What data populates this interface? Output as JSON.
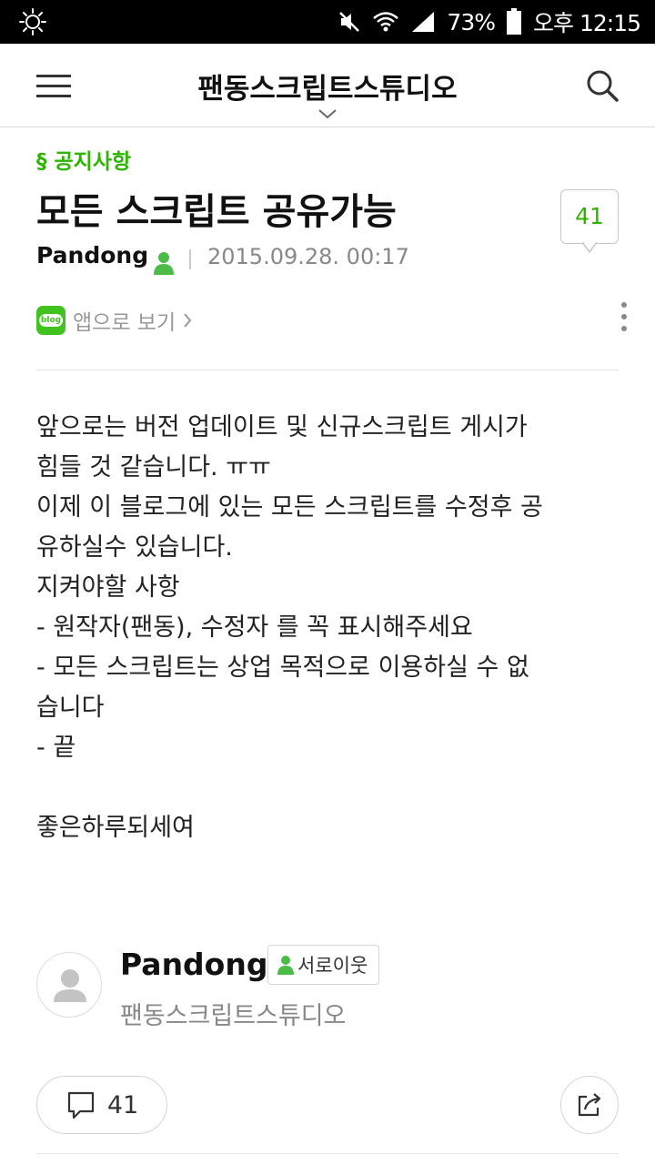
{
  "status_bar": {
    "battery": "73%",
    "time": "오후 12:15",
    "icons": [
      "brightness-icon",
      "mute-icon",
      "wifi-icon",
      "signal-icon",
      "battery-icon"
    ]
  },
  "app_bar": {
    "blog_title": "팬동스크립트스튜디오",
    "icons": [
      "menu-icon",
      "chevron-down-icon",
      "search-icon"
    ]
  },
  "post": {
    "category": "§ 공지사항",
    "title": "모든 스크립트 공유가능",
    "comment_count": "41",
    "author": "Pandong",
    "date": "2015.09.28. 00:17",
    "app_view_label": "앱으로 보기",
    "blog_logo_text": "blog",
    "body_lines": [
      "앞으로는 버전 업데이트 및 신규스크립트 게시가",
      "힘들 것 같습니다. ㅠㅠ",
      "이제 이 블로그에 있는 모든 스크립트를 수정후 공",
      "유하실수 있습니다.",
      "지켜야할 사항",
      "- 원작자(팬동), 수정자 를 꼭 표시해주세요",
      "- 모든 스크립트는 상업 목적으로 이용하실 수 없",
      "습니다",
      "- 끝",
      "",
      "좋은하루되세여"
    ]
  },
  "author_card": {
    "name": "Pandong",
    "neighbor_badge": "서로이웃",
    "blog_name": "팬동스크립트스튜디오"
  },
  "actions": {
    "comment_count": "41"
  },
  "colors": {
    "accent_green": "#2db400",
    "status_bar": "#000000"
  }
}
